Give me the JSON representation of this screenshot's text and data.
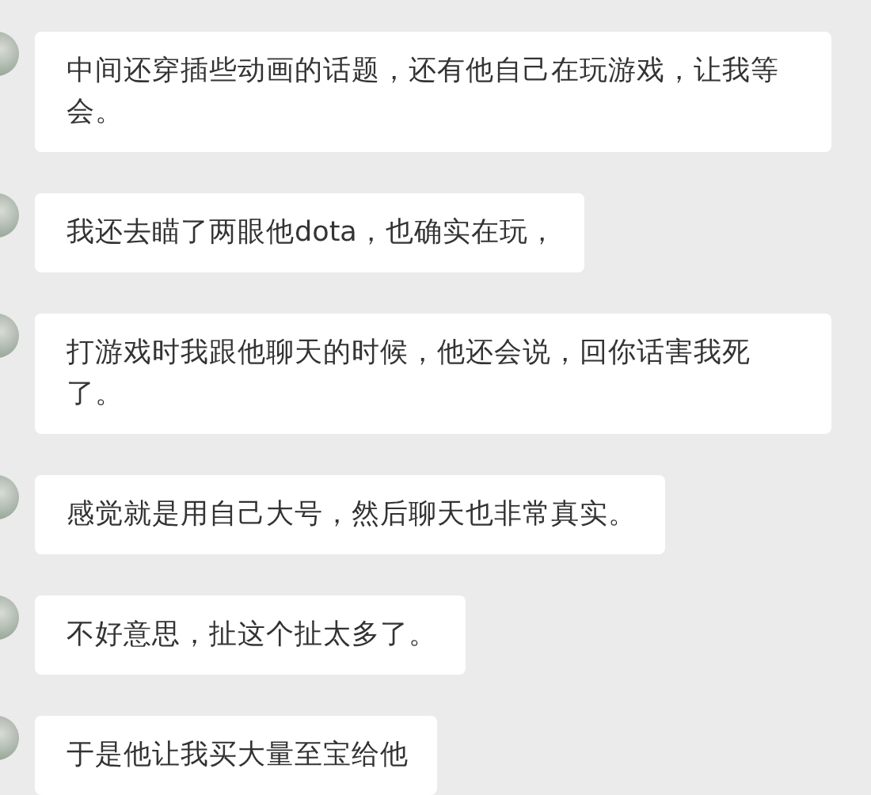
{
  "messages": [
    {
      "text": "中间还穿插些动画的话题，还有他自己在玩游戏，让我等会。"
    },
    {
      "text": "我还去瞄了两眼他dota，也确实在玩，"
    },
    {
      "text": "打游戏时我跟他聊天的时候，他还会说，回你话害我死了。"
    },
    {
      "text": "感觉就是用自己大号，然后聊天也非常真实。"
    },
    {
      "text": "不好意思，扯这个扯太多了。"
    },
    {
      "text": "于是他让我买大量至宝给他"
    }
  ]
}
